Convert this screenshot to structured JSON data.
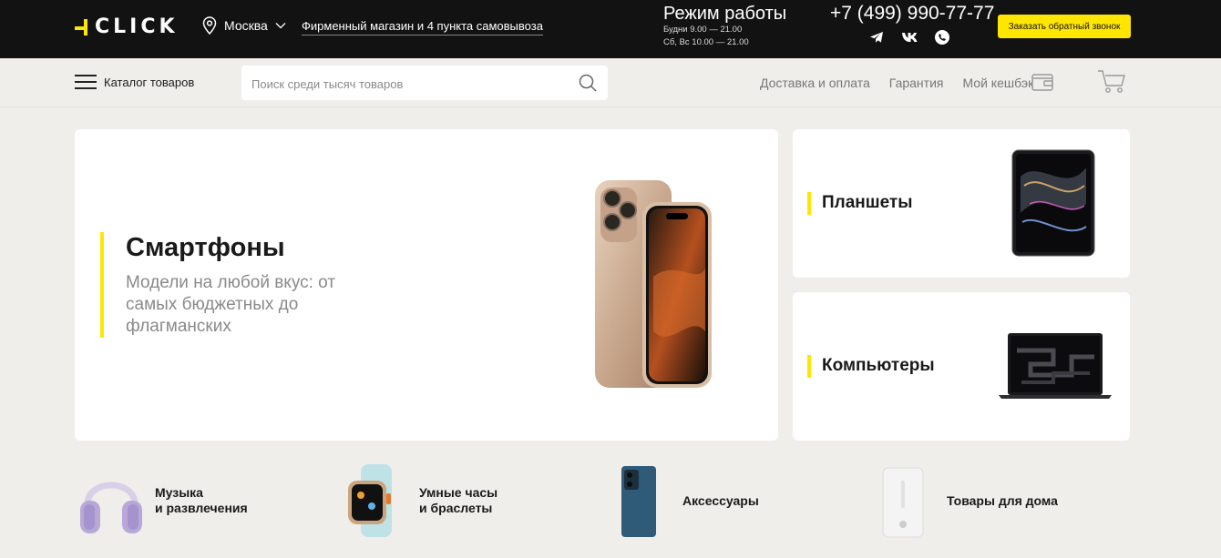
{
  "header": {
    "logo_text": "CLICK",
    "logo_full": "1CLICK",
    "city": "Москва",
    "shops_link": "Фирменный магазин и 4 пункта самовывоза",
    "hours_title": "Режим работы",
    "hours_weekdays": "Будни 9.00 — 21.00",
    "hours_weekend": "Сб, Вс 10.00 — 21.00",
    "phone": "+7 (499) 990-77-77",
    "callback_label": "Заказать обратный звонок",
    "socials": [
      "telegram-icon",
      "vk-icon",
      "whatsapp-icon"
    ],
    "accent_color": "#ffe600",
    "background_color": "#121212"
  },
  "nav": {
    "catalog_label": "Каталог товаров",
    "search_placeholder": "Поиск среди тысяч товаров",
    "search_value": "",
    "links": [
      "Доставка и оплата",
      "Гарантия",
      "Мой кешбэк"
    ]
  },
  "main": {
    "hero": {
      "title": "Смартфоны",
      "subtitle": "Модели на любой вкус: от самых бюджетных до флагманских"
    },
    "tablets": {
      "title": "Планшеты"
    },
    "computers": {
      "title": "Компьютеры"
    }
  },
  "categories": [
    {
      "label": "Музыка\nи развлечения",
      "icon": "headphones-icon"
    },
    {
      "label": "Умные часы\nи браслеты",
      "icon": "smartwatch-icon"
    },
    {
      "label": "Аксессуары",
      "icon": "phone-case-icon"
    },
    {
      "label": "Товары для дома",
      "icon": "humidifier-icon"
    }
  ]
}
